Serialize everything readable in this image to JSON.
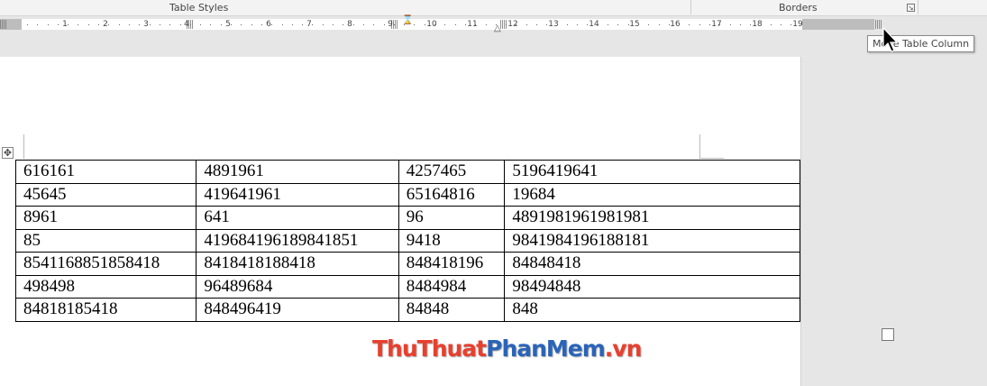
{
  "ribbon": {
    "group_table_styles": "Table Styles",
    "group_borders": "Borders"
  },
  "ruler": {
    "numbers_left": [
      "1",
      "2",
      "3",
      "4",
      "5",
      "6",
      "7",
      "8",
      "9"
    ],
    "numbers_right": [
      "10",
      "11",
      "12",
      "13",
      "14",
      "15",
      "16",
      "17",
      "18",
      "19"
    ]
  },
  "tooltip": {
    "text": "Move Table Column"
  },
  "table": {
    "rows": [
      [
        "616161",
        "4891961",
        "4257465",
        "5196419641"
      ],
      [
        "45645",
        "419641961",
        "65164816",
        "19684"
      ],
      [
        "8961",
        "641",
        "96",
        "4891981961981981"
      ],
      [
        "85",
        "419684196189841851",
        "9418",
        "9841984196188181"
      ],
      [
        "8541168851858418",
        "8418418188418",
        "848418196",
        "84848418"
      ],
      [
        "498498",
        "96489684",
        "8484984",
        "98494848"
      ],
      [
        "84818185418",
        "848496419",
        "84848",
        "848"
      ]
    ]
  },
  "watermark": {
    "part1": "ThuThuat",
    "part2": "PhanMem",
    "part3": ".vn"
  },
  "colors": {
    "watermark_red": "#e8402e",
    "watermark_blue": "#2a64b8",
    "ruler_gray": "#bdbdbd"
  }
}
